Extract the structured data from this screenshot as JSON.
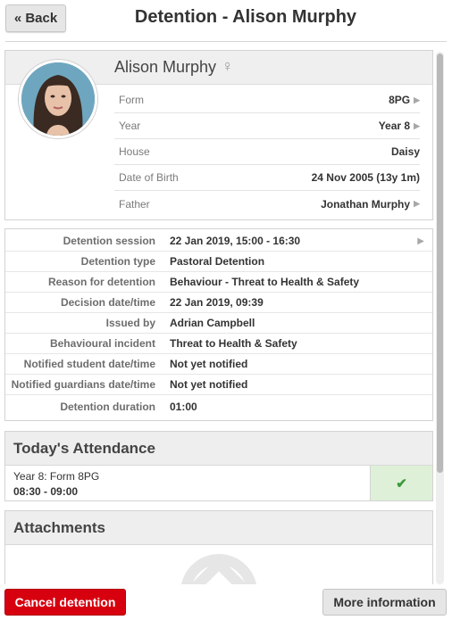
{
  "header": {
    "back_label": "« Back",
    "title": "Detention - Alison Murphy"
  },
  "student": {
    "name": "Alison Murphy",
    "gender_symbol": "♀",
    "avatar_icon": "student-photo",
    "rows": [
      {
        "label": "Form",
        "value": "8PG",
        "chevron": "▶"
      },
      {
        "label": "Year",
        "value": "Year 8",
        "chevron": "▶"
      },
      {
        "label": "House",
        "value": "Daisy",
        "chevron": ""
      },
      {
        "label": "Date of Birth",
        "value": "24 Nov 2005 (13y 1m)",
        "chevron": ""
      },
      {
        "label": "Father",
        "value": "Jonathan Murphy",
        "chevron": "▶"
      }
    ]
  },
  "detention": {
    "rows": [
      {
        "label": "Detention session",
        "value": "22 Jan 2019, 15:00 - 16:30",
        "chevron": "▶"
      },
      {
        "label": "Detention type",
        "value": "Pastoral Detention",
        "chevron": ""
      },
      {
        "label": "Reason for detention",
        "value": "Behaviour - Threat to Health & Safety",
        "chevron": ""
      },
      {
        "label": "Decision date/time",
        "value": "22 Jan 2019, 09:39",
        "chevron": ""
      },
      {
        "label": "Issued by",
        "value": "Adrian Campbell",
        "chevron": ""
      },
      {
        "label": "Behavioural incident",
        "value": "Threat to Health & Safety",
        "chevron": ""
      },
      {
        "label": "Notified student date/time",
        "value": "Not yet notified",
        "chevron": ""
      },
      {
        "label": "Notified guardians date/time",
        "value": "Not yet notified",
        "chevron": ""
      },
      {
        "label": "Detention duration",
        "value": "01:00",
        "chevron": ""
      }
    ]
  },
  "attendance": {
    "heading": "Today's Attendance",
    "line1": "Year 8: Form 8PG",
    "line2": "08:30 - 09:00",
    "status_symbol": "✔",
    "status_color": "#3c9a3c"
  },
  "attachments": {
    "heading": "Attachments",
    "icon": "upload-icon"
  },
  "footer": {
    "cancel_label": "Cancel detention",
    "cancel_color": "#d7000f",
    "more_label": "More information"
  }
}
